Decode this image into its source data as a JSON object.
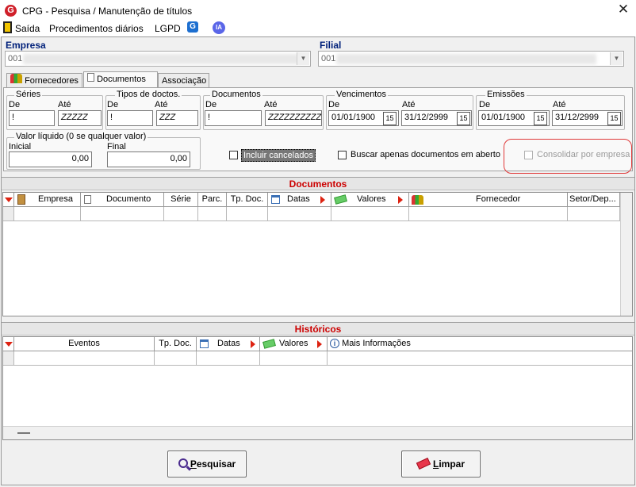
{
  "window": {
    "title": "CPG - Pesquisa / Manutenção de títulos",
    "close_glyph": "✕",
    "logo_letter": "G"
  },
  "menu": {
    "items": [
      "Saída",
      "Procedimentos diários",
      "LGPD"
    ],
    "g_badge": "G",
    "ia_badge": "IA"
  },
  "empresa": {
    "label": "Empresa",
    "value": "001"
  },
  "filial": {
    "label": "Filial",
    "value": "001"
  },
  "tabs": [
    "Fornecedores",
    "Documentos",
    "Associação"
  ],
  "filters": {
    "series": {
      "title": "Séries",
      "de_label": "De",
      "ate_label": "Até",
      "de": "!",
      "ate": "ZZZZZ"
    },
    "tipos": {
      "title": "Tipos de doctos.",
      "de_label": "De",
      "ate_label": "Até",
      "de": "!",
      "ate": "ZZZ"
    },
    "documentos": {
      "title": "Documentos",
      "de_label": "De",
      "ate_label": "Até",
      "de": "!",
      "ate": "ZZZZZZZZZZZZZZZZ"
    },
    "vencimentos": {
      "title": "Vencimentos",
      "de_label": "De",
      "ate_label": "Até",
      "de": "01/01/1900",
      "ate": "31/12/2999"
    },
    "emissoes": {
      "title": "Emissões",
      "de_label": "De",
      "ate_label": "Até",
      "de": "01/01/1900",
      "ate": "31/12/2999"
    },
    "valor": {
      "title": "Valor líquido (0 se qualquer valor)",
      "inicial_label": "Inicial",
      "final_label": "Final",
      "inicial": "0,00",
      "final": "0,00"
    },
    "cal_glyph": "15"
  },
  "options": {
    "incluir_cancelados": "Incluir cancelados",
    "buscar_abertos": "Buscar apenas documentos em aberto",
    "consolidar": "Consolidar por empresa"
  },
  "documentos_grid": {
    "title": "Documentos",
    "columns": [
      "Empresa",
      "Documento",
      "Série",
      "Parc.",
      "Tp. Doc.",
      "Datas",
      "Valores",
      "Fornecedor",
      "Setor/Dep..."
    ]
  },
  "historicos_grid": {
    "title": "Históricos",
    "columns": [
      "Eventos",
      "Tp. Doc.",
      "Datas",
      "Valores",
      "Mais Informações"
    ]
  },
  "buttons": {
    "pesquisar_first": "P",
    "pesquisar_rest": "esquisar",
    "limpar_first": "L",
    "limpar_rest": "impar"
  },
  "colors": {
    "accent_red": "#cc0000",
    "label_blue": "#00207a"
  }
}
